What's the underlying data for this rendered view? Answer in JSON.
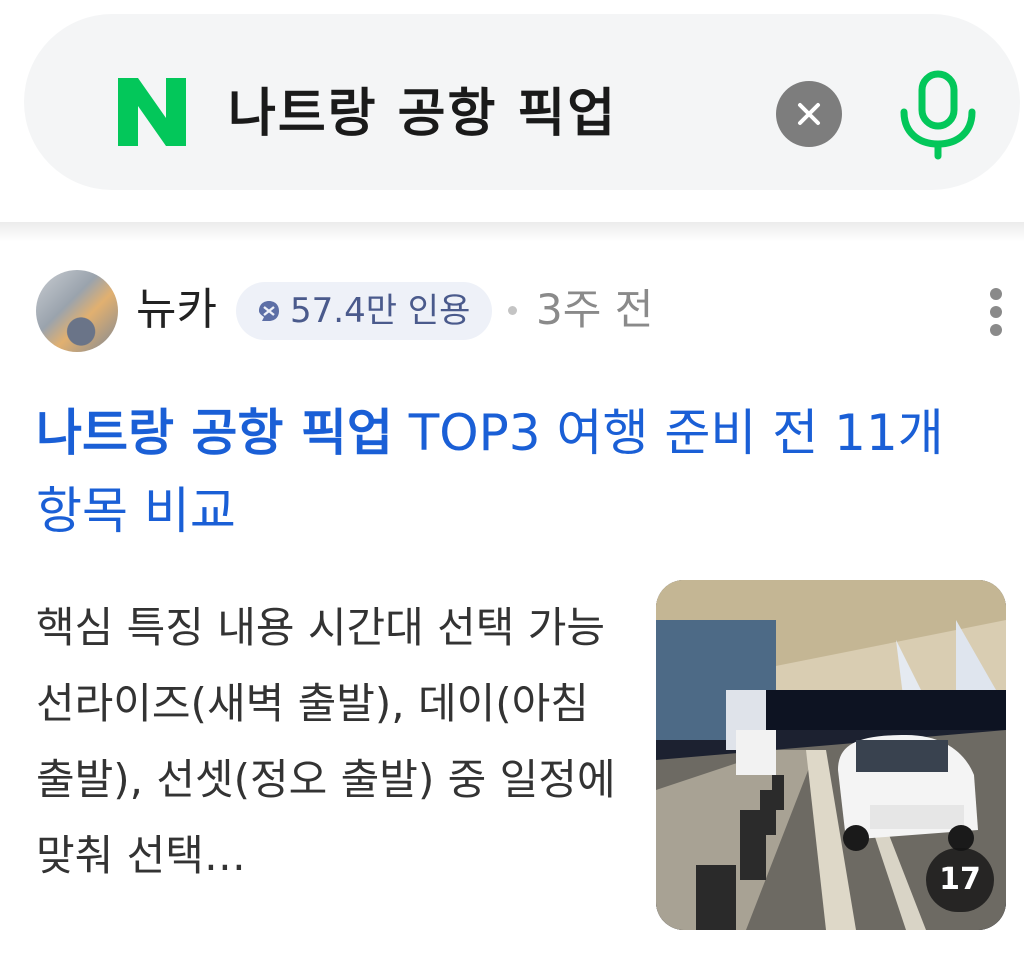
{
  "search": {
    "logo_letter": "N",
    "query": "나트랑 공항 픽업",
    "brand_color": "#03c75a"
  },
  "post": {
    "author_name": "뉴카",
    "badge_text": "57.4만 인용",
    "time": "3주 전",
    "title_highlight": "나트랑 공항 픽업",
    "title_rest": " TOP3 여행 준비 전 11개 항목 비교",
    "description": "핵심 특징 내용 시간대 선택 가능 선라이즈(새벽 출발), 데이(아침 출발), 선셋(정오 출발) 중 일정에 맞춰 선택…",
    "image_count": "17",
    "title_color": "#1a5fd6"
  },
  "icons": {
    "clear": "close-icon",
    "mic": "microphone-icon",
    "more": "more-vertical-icon",
    "badge": "quote-icon"
  }
}
